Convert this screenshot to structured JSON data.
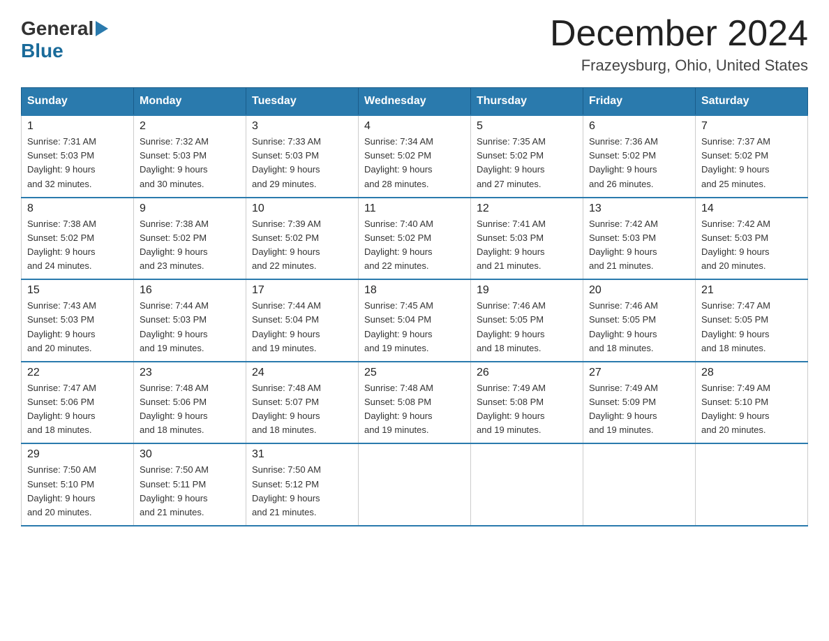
{
  "logo": {
    "general": "General",
    "blue": "Blue"
  },
  "header": {
    "title": "December 2024",
    "subtitle": "Frazeysburg, Ohio, United States"
  },
  "weekdays": [
    "Sunday",
    "Monday",
    "Tuesday",
    "Wednesday",
    "Thursday",
    "Friday",
    "Saturday"
  ],
  "weeks": [
    [
      {
        "day": "1",
        "sunrise": "7:31 AM",
        "sunset": "5:03 PM",
        "daylight": "9 hours and 32 minutes."
      },
      {
        "day": "2",
        "sunrise": "7:32 AM",
        "sunset": "5:03 PM",
        "daylight": "9 hours and 30 minutes."
      },
      {
        "day": "3",
        "sunrise": "7:33 AM",
        "sunset": "5:03 PM",
        "daylight": "9 hours and 29 minutes."
      },
      {
        "day": "4",
        "sunrise": "7:34 AM",
        "sunset": "5:02 PM",
        "daylight": "9 hours and 28 minutes."
      },
      {
        "day": "5",
        "sunrise": "7:35 AM",
        "sunset": "5:02 PM",
        "daylight": "9 hours and 27 minutes."
      },
      {
        "day": "6",
        "sunrise": "7:36 AM",
        "sunset": "5:02 PM",
        "daylight": "9 hours and 26 minutes."
      },
      {
        "day": "7",
        "sunrise": "7:37 AM",
        "sunset": "5:02 PM",
        "daylight": "9 hours and 25 minutes."
      }
    ],
    [
      {
        "day": "8",
        "sunrise": "7:38 AM",
        "sunset": "5:02 PM",
        "daylight": "9 hours and 24 minutes."
      },
      {
        "day": "9",
        "sunrise": "7:38 AM",
        "sunset": "5:02 PM",
        "daylight": "9 hours and 23 minutes."
      },
      {
        "day": "10",
        "sunrise": "7:39 AM",
        "sunset": "5:02 PM",
        "daylight": "9 hours and 22 minutes."
      },
      {
        "day": "11",
        "sunrise": "7:40 AM",
        "sunset": "5:02 PM",
        "daylight": "9 hours and 22 minutes."
      },
      {
        "day": "12",
        "sunrise": "7:41 AM",
        "sunset": "5:03 PM",
        "daylight": "9 hours and 21 minutes."
      },
      {
        "day": "13",
        "sunrise": "7:42 AM",
        "sunset": "5:03 PM",
        "daylight": "9 hours and 21 minutes."
      },
      {
        "day": "14",
        "sunrise": "7:42 AM",
        "sunset": "5:03 PM",
        "daylight": "9 hours and 20 minutes."
      }
    ],
    [
      {
        "day": "15",
        "sunrise": "7:43 AM",
        "sunset": "5:03 PM",
        "daylight": "9 hours and 20 minutes."
      },
      {
        "day": "16",
        "sunrise": "7:44 AM",
        "sunset": "5:03 PM",
        "daylight": "9 hours and 19 minutes."
      },
      {
        "day": "17",
        "sunrise": "7:44 AM",
        "sunset": "5:04 PM",
        "daylight": "9 hours and 19 minutes."
      },
      {
        "day": "18",
        "sunrise": "7:45 AM",
        "sunset": "5:04 PM",
        "daylight": "9 hours and 19 minutes."
      },
      {
        "day": "19",
        "sunrise": "7:46 AM",
        "sunset": "5:05 PM",
        "daylight": "9 hours and 18 minutes."
      },
      {
        "day": "20",
        "sunrise": "7:46 AM",
        "sunset": "5:05 PM",
        "daylight": "9 hours and 18 minutes."
      },
      {
        "day": "21",
        "sunrise": "7:47 AM",
        "sunset": "5:05 PM",
        "daylight": "9 hours and 18 minutes."
      }
    ],
    [
      {
        "day": "22",
        "sunrise": "7:47 AM",
        "sunset": "5:06 PM",
        "daylight": "9 hours and 18 minutes."
      },
      {
        "day": "23",
        "sunrise": "7:48 AM",
        "sunset": "5:06 PM",
        "daylight": "9 hours and 18 minutes."
      },
      {
        "day": "24",
        "sunrise": "7:48 AM",
        "sunset": "5:07 PM",
        "daylight": "9 hours and 18 minutes."
      },
      {
        "day": "25",
        "sunrise": "7:48 AM",
        "sunset": "5:08 PM",
        "daylight": "9 hours and 19 minutes."
      },
      {
        "day": "26",
        "sunrise": "7:49 AM",
        "sunset": "5:08 PM",
        "daylight": "9 hours and 19 minutes."
      },
      {
        "day": "27",
        "sunrise": "7:49 AM",
        "sunset": "5:09 PM",
        "daylight": "9 hours and 19 minutes."
      },
      {
        "day": "28",
        "sunrise": "7:49 AM",
        "sunset": "5:10 PM",
        "daylight": "9 hours and 20 minutes."
      }
    ],
    [
      {
        "day": "29",
        "sunrise": "7:50 AM",
        "sunset": "5:10 PM",
        "daylight": "9 hours and 20 minutes."
      },
      {
        "day": "30",
        "sunrise": "7:50 AM",
        "sunset": "5:11 PM",
        "daylight": "9 hours and 21 minutes."
      },
      {
        "day": "31",
        "sunrise": "7:50 AM",
        "sunset": "5:12 PM",
        "daylight": "9 hours and 21 minutes."
      },
      null,
      null,
      null,
      null
    ]
  ],
  "labels": {
    "sunrise": "Sunrise:",
    "sunset": "Sunset:",
    "daylight": "Daylight:"
  }
}
